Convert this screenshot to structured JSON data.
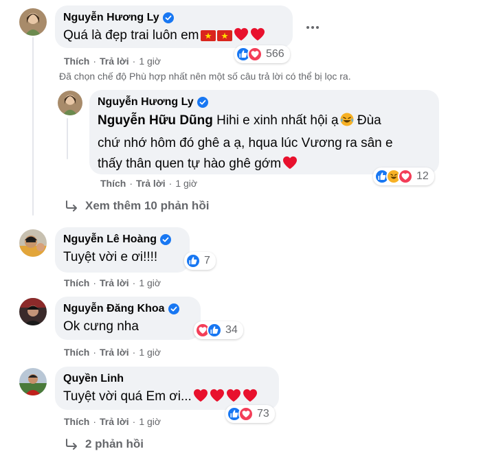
{
  "comments": [
    {
      "author": "Nguyễn Hương Ly",
      "text": "Quá là đẹp trai luôn em",
      "reaction_count": "566",
      "actions": {
        "like": "Thích",
        "reply": "Trả lời",
        "time": "1 giờ"
      }
    },
    {
      "author": "Nguyễn Hương Ly",
      "mention": "Nguyễn Hữu Dũng",
      "text_line1": "Hihi e xinh nhất hội ạ",
      "text_line1b": "Đùa",
      "text_line2": "chứ nhớ hôm đó ghê a ạ, hqua lúc Vương ra sân e",
      "text_line3": "thấy thân quen tự hào ghê gớm",
      "reaction_count": "12",
      "actions": {
        "like": "Thích",
        "reply": "Trả lời",
        "time": "1 giờ"
      }
    },
    {
      "author": "Nguyễn Lê Hoàng",
      "text": "Tuyệt vời e ơi!!!!",
      "reaction_count": "7",
      "actions": {
        "like": "Thích",
        "reply": "Trả lời",
        "time": "1 giờ"
      }
    },
    {
      "author": "Nguyễn Đăng Khoa",
      "text": "Ok cưng nha",
      "reaction_count": "34",
      "actions": {
        "like": "Thích",
        "reply": "Trả lời",
        "time": "1 giờ"
      }
    },
    {
      "author": "Quyền Linh",
      "text": "Tuyệt vời quá Em ơi...",
      "reaction_count": "73",
      "actions": {
        "like": "Thích",
        "reply": "Trả lời",
        "time": "1 giờ"
      }
    }
  ],
  "filter_note": "Đã chọn chế độ Phù hợp nhất nên một số câu trả lời có thể bị lọc ra.",
  "view_more_replies": "Xem thêm 10 phản hồi",
  "replies_link": "2 phản hồi",
  "colors": {
    "bubble": "#f0f2f5",
    "secondary_text": "#65676b",
    "verified_blue": "#1877f2",
    "like_blue": "#1877f2",
    "love_red": "#f33e58",
    "haha_yellow": "#f7b125"
  }
}
